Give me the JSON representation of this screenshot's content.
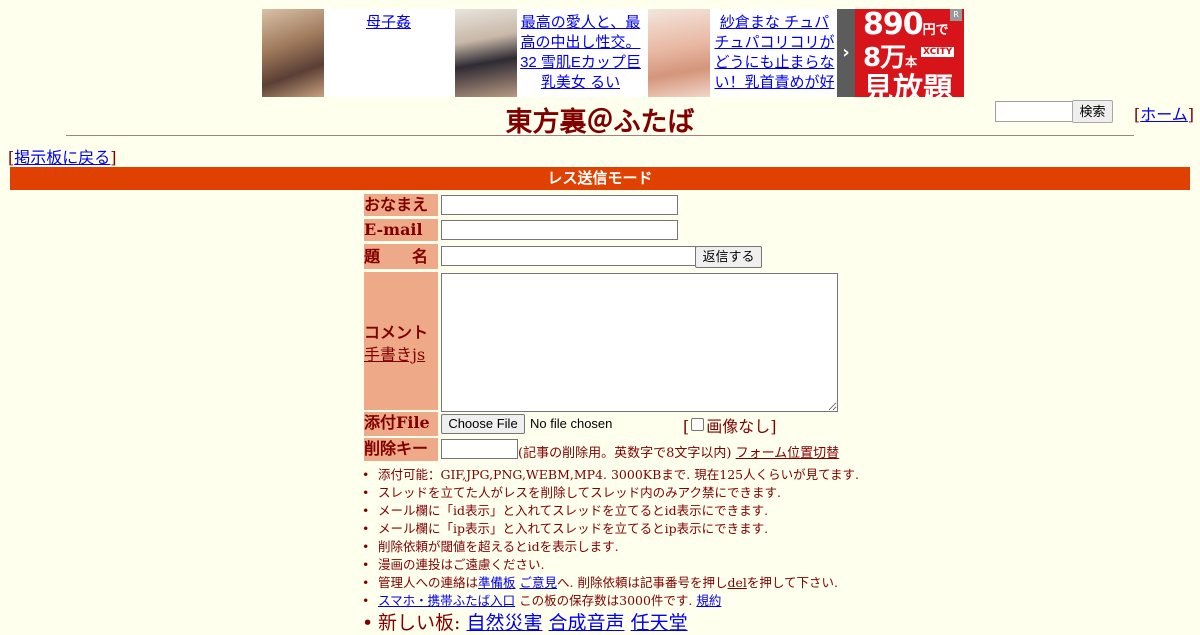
{
  "ads": [
    {
      "title": "母子姦"
    },
    {
      "title": "最高の愛人と、最高の中出し性交。32 雪肌Eカップ巨乳美女 るい"
    },
    {
      "title": "紗倉まな チュパチュパコリコリがどうにも止まらない！乳首責めが好"
    }
  ],
  "banner": {
    "price": "890",
    "price_unit": "円で",
    "count": "8万",
    "count_unit": "本",
    "brand": "XCITY",
    "tagline": "見放題",
    "arrow": "›",
    "corner": "R"
  },
  "header": {
    "title": "東方裏＠ふたば",
    "search_button": "検索",
    "home_link": "ホーム",
    "back_link": "掲示板に戻る"
  },
  "mode_bar": "レス送信モード",
  "form": {
    "name_label": "おなまえ",
    "email_label": "E-mail",
    "subject_label": "題　　名",
    "reply_button": "返信する",
    "comment_label": "コメント",
    "handwriting_link": "手書きjs",
    "file_label": "添付File",
    "choose_file": "Choose File",
    "no_file": "No file chosen",
    "no_image": "画像なし",
    "delkey_label": "削除キー",
    "delkey_note": "(記事の削除用。英数字で8文字以内)",
    "form_toggle": "フォーム位置切替"
  },
  "rules": {
    "r1": "添付可能：GIF,JPG,PNG,WEBM,MP4. 3000KBまで. 現在125人くらいが見てます.",
    "r2": "スレッドを立てた人がレスを削除してスレッド内のみアク禁にできます.",
    "r3": "メール欄に「id表示」と入れてスレッドを立てるとid表示にできます.",
    "r4": "メール欄に「ip表示」と入れてスレッドを立てるとip表示にできます.",
    "r5": "削除依頼が閾値を超えるとidを表示します.",
    "r6": "漫画の連投はご遠慮ください.",
    "r7_pre": "管理人への連絡は",
    "r7_link1": "準備板",
    "r7_link2": "ご意見",
    "r7_mid": "へ. 削除依頼は記事番号を押し",
    "r7_del": "del",
    "r7_post": "を押して下さい.",
    "r8_link1": "スマホ・携帯ふたば入口",
    "r8_mid": " この板の保存数は3000件です. ",
    "r8_link2": "規約"
  },
  "new_boards": {
    "label": "新しい板: ",
    "boards": [
      "自然災害",
      "合成音声",
      "任天堂"
    ]
  }
}
